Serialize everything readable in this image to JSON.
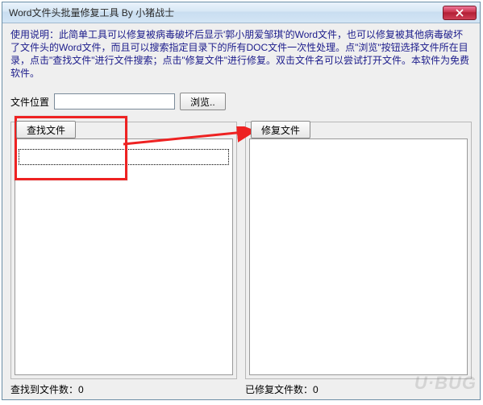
{
  "window": {
    "title": "Word文件头批量修复工具  By 小猪战士"
  },
  "instructions": "使用说明：此简单工具可以修复被病毒破坏后显示'郭小朋爱邹琪'的Word文件，也可以修复被其他病毒破坏了文件头的Word文件，而且可以搜索指定目录下的所有DOC文件一次性处理。点\"浏览\"按钮选择文件所在目录，点击\"查找文件\"进行文件搜索；点击\"修复文件\"进行修复。双击文件名可以尝试打开文件。本软件为免费软件。",
  "fileLocation": {
    "label": "文件位置",
    "value": "",
    "browse": "浏览.."
  },
  "panels": {
    "left": {
      "button": "查找文件"
    },
    "right": {
      "button": "修复文件"
    }
  },
  "status": {
    "foundLabel": "查找到文件数：",
    "foundCount": "0",
    "repairedLabel": "已修复文件数：",
    "repairedCount": "0"
  },
  "watermark": "U·BUG"
}
